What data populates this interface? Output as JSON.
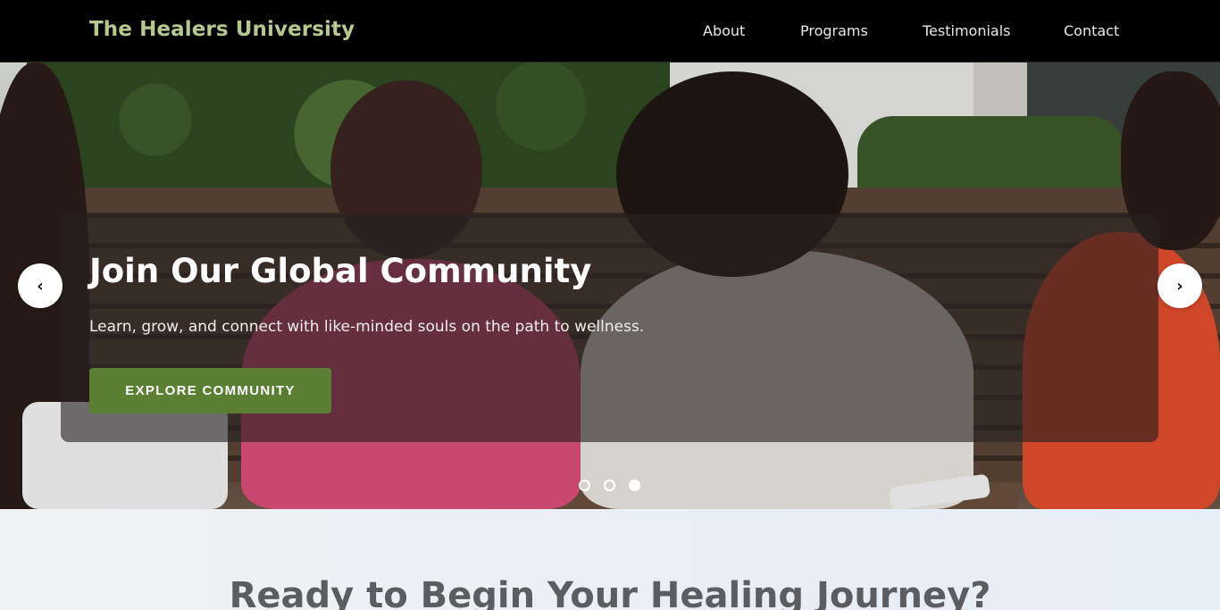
{
  "nav": {
    "brand": "The Healers University",
    "links": [
      "About",
      "Programs",
      "Testimonials",
      "Contact"
    ]
  },
  "hero": {
    "title": "Join Our Global Community",
    "text": "Learn, grow, and connect with like-minded souls on the path to wellness.",
    "cta_label": "EXPLORE COMMUNITY",
    "prev_icon": "chevron-left-icon",
    "next_icon": "chevron-right-icon",
    "prev_glyph": "‹",
    "next_glyph": "›",
    "slide_count": 3,
    "active_slide": 3
  },
  "cta_section": {
    "heading": "Ready to Begin Your Healing Journey?"
  },
  "colors": {
    "brand": "#b5c98f",
    "button": "#5a7f33",
    "nav_bg": "#000000"
  }
}
